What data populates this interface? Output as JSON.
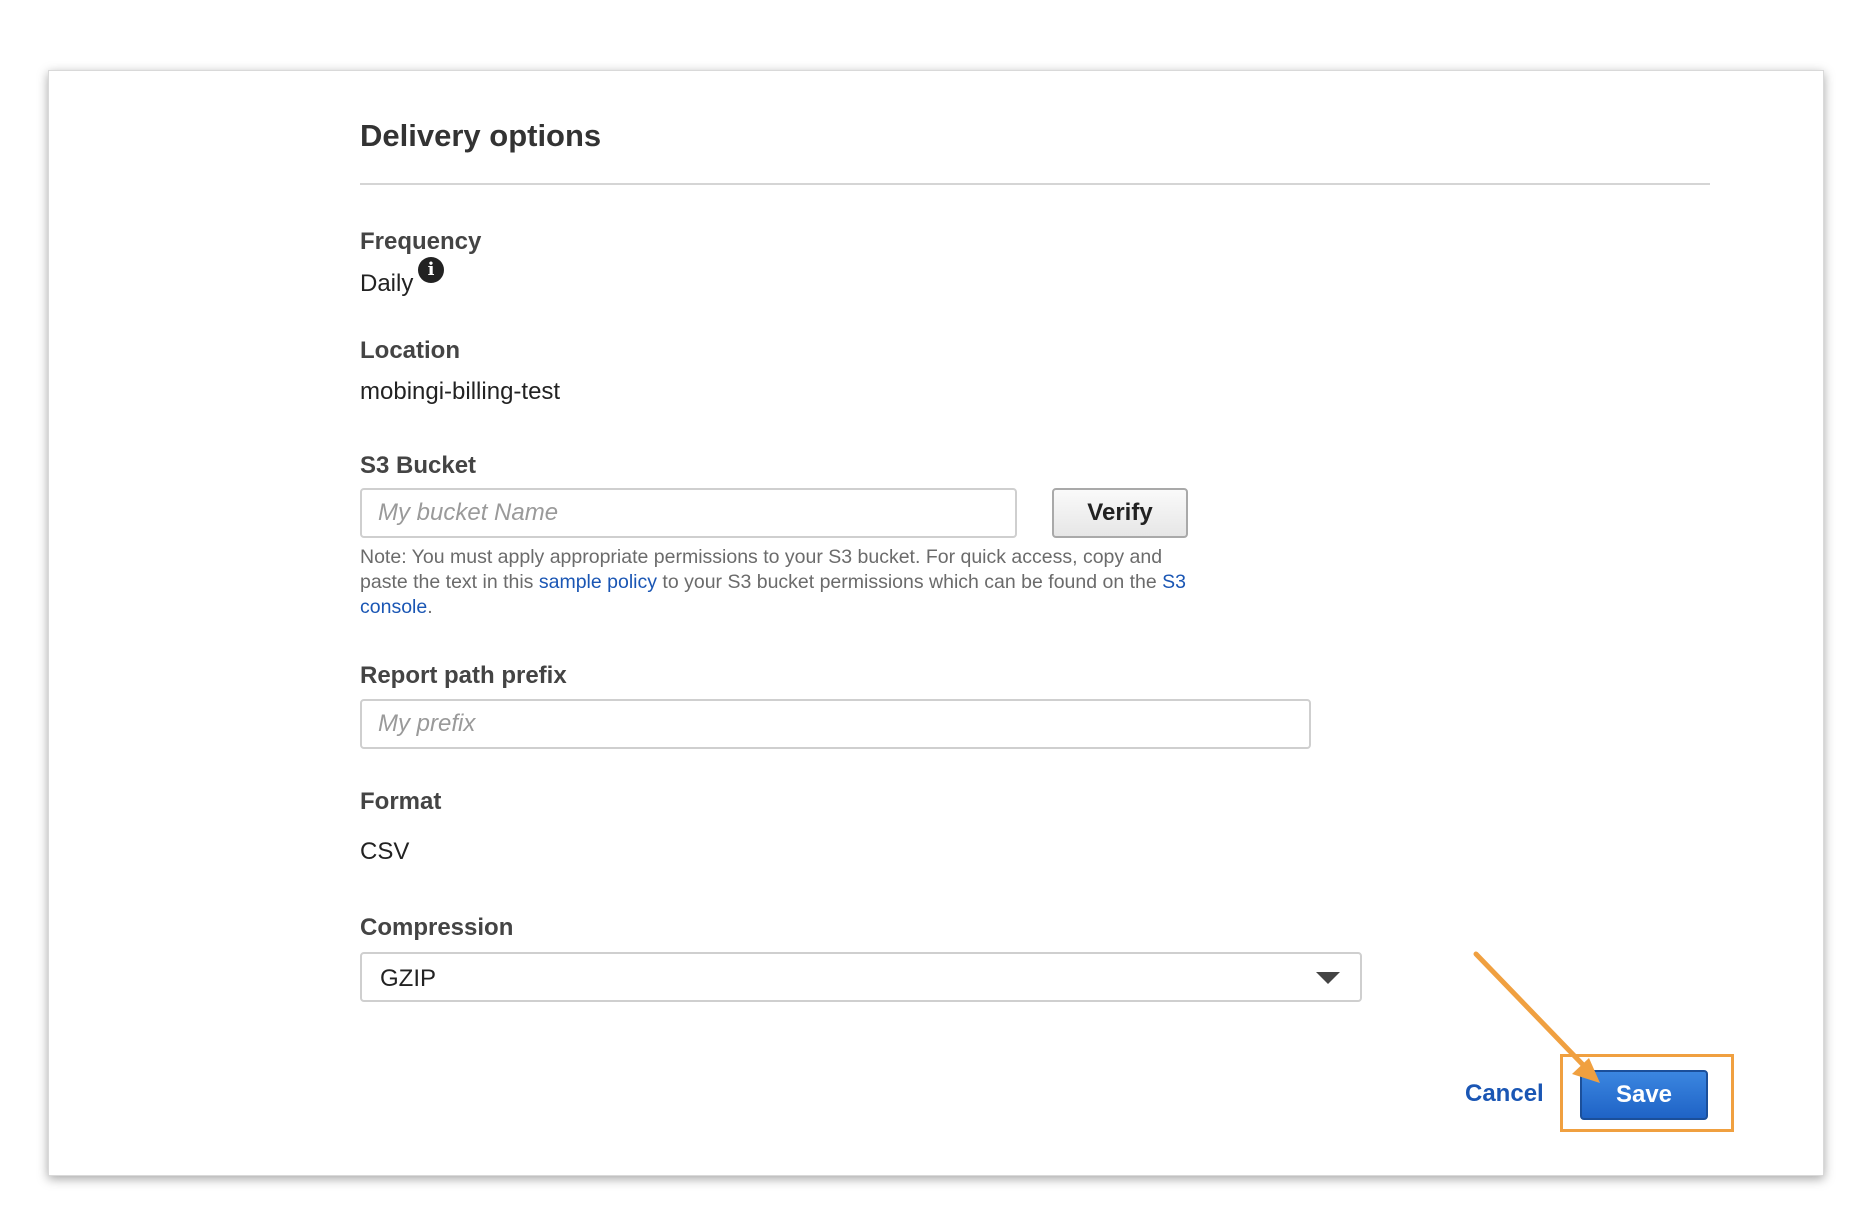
{
  "header": {
    "title": "Delivery options"
  },
  "frequency": {
    "label": "Frequency",
    "value": "Daily",
    "info_icon": "info-circle-icon"
  },
  "location": {
    "label": "Location",
    "value": "mobingi-billing-test"
  },
  "s3_bucket": {
    "label": "S3 Bucket",
    "placeholder": "My bucket Name",
    "value": "",
    "verify_label": "Verify",
    "note_prefix": "Note: You must apply appropriate permissions to your S3 bucket. For quick access, copy and paste the text in this ",
    "note_link1": "sample policy",
    "note_middle": " to your S3 bucket permissions which can be found on the ",
    "note_link2": "S3 console",
    "note_suffix": "."
  },
  "report_path_prefix": {
    "label": "Report path prefix",
    "placeholder": "My prefix",
    "value": ""
  },
  "format": {
    "label": "Format",
    "value": "CSV"
  },
  "compression": {
    "label": "Compression",
    "selected": "GZIP",
    "caret_icon": "caret-down-icon"
  },
  "actions": {
    "cancel_label": "Cancel",
    "save_label": "Save"
  },
  "annotation": {
    "highlight_color": "#f0a040",
    "arrow_icon": "arrow-annotation-icon"
  },
  "colors": {
    "link": "#1a56b4",
    "primary_button": "#2a72d4"
  }
}
